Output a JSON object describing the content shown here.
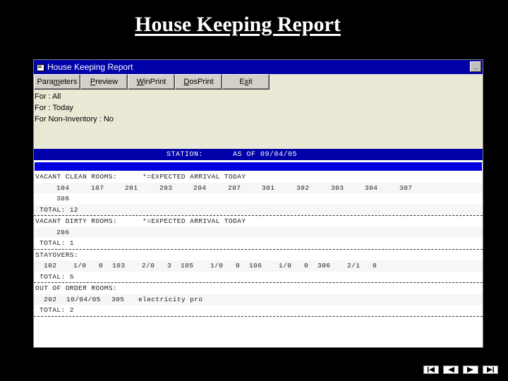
{
  "slide": {
    "title": "House Keeping Report"
  },
  "window": {
    "title": "House Keeping Report",
    "minimize_glyph": "_"
  },
  "toolbar": {
    "parameters": {
      "pre": "Para",
      "u": "m",
      "post": "eters"
    },
    "preview": {
      "pre": "",
      "u": "P",
      "post": "review"
    },
    "winprint": {
      "pre": "",
      "u": "W",
      "post": "inPrint"
    },
    "dosprint": {
      "pre": "",
      "u": "D",
      "post": "osPrint"
    },
    "exit": {
      "pre": "E",
      "u": "x",
      "post": "it"
    }
  },
  "filters": {
    "line1": "For : All",
    "line2": "For : Today",
    "line3": "For Non-Inventory : No"
  },
  "station": {
    "label": "STATION:",
    "as_of": "AS OF 09/04/05"
  },
  "report": {
    "vacant_clean": {
      "header": "VACANT CLEAN ROOMS:",
      "note": "*=EXPECTED ARRIVAL TODAY",
      "rooms_row1": [
        "104",
        "107",
        "201",
        "203",
        "204",
        "207",
        "301",
        "302",
        "303",
        "304",
        "307"
      ],
      "rooms_row2": [
        "308"
      ],
      "total": "TOTAL: 12"
    },
    "vacant_dirty": {
      "header": "VACANT DIRTY ROOMS:",
      "note": "*=EXPECTED ARRIVAL TODAY",
      "rooms": [
        "206"
      ],
      "total": "TOTAL: 1"
    },
    "stayovers": {
      "header": "STAYOVERS:",
      "rows": [
        [
          "102",
          "1/0",
          "0"
        ],
        [
          "103",
          "2/0",
          "3"
        ],
        [
          "105",
          "1/0",
          "0"
        ],
        [
          "106",
          "1/0",
          "0"
        ],
        [
          "306",
          "2/1",
          "0"
        ]
      ],
      "total": "TOTAL: 5"
    },
    "out_of_order": {
      "header": "OUT OF ORDER ROOMS:",
      "row": [
        "202",
        "10/04/05",
        "305",
        "electricity pro"
      ],
      "total": "TOTAL: 2"
    }
  },
  "nav": {
    "first": "first-slide-icon",
    "prev": "previous-slide-icon",
    "next": "next-slide-icon",
    "last": "last-slide-icon"
  }
}
